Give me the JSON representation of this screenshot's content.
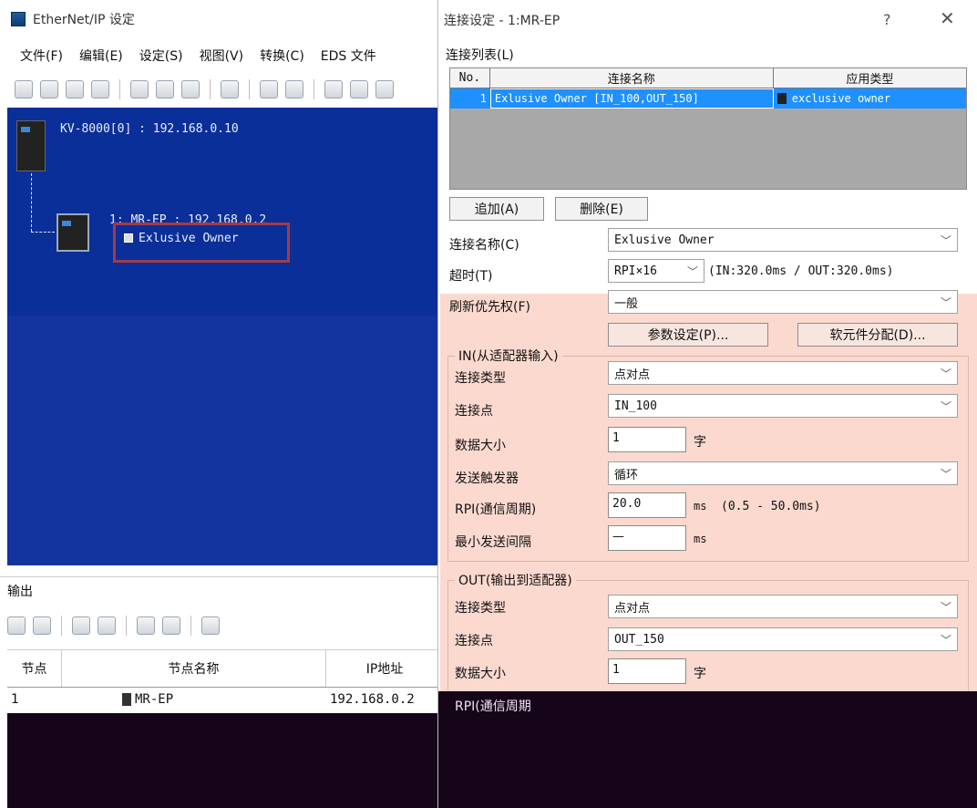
{
  "main_window": {
    "title": "EtherNet/IP 设定",
    "menu": [
      "文件(F)",
      "编辑(E)",
      "设定(S)",
      "视图(V)",
      "转换(C)",
      "EDS 文件"
    ],
    "plc_label": "KV-8000[0] : 192.168.0.10",
    "node_label": "1: MR-EP : 192.168.0.2",
    "connection_label": "Exlusive Owner"
  },
  "output_panel": {
    "title": "输出",
    "columns": [
      "节点",
      "节点名称",
      "IP地址"
    ],
    "rows": [
      {
        "node": "1",
        "name": "MR-EP",
        "ip": "192.168.0.2"
      }
    ]
  },
  "dialog": {
    "title": "连接设定 - 1:MR-EP",
    "help": "?",
    "close": "✕",
    "list_label": "连接列表(L)",
    "list_columns": [
      "No.",
      "连接名称",
      "应用类型"
    ],
    "list_rows": [
      {
        "no": "1",
        "name": "Exlusive Owner [IN_100,OUT_150]",
        "type": "exclusive owner"
      }
    ],
    "add_button": "追加(A)",
    "delete_button": "删除(E)",
    "conn_name_label": "连接名称(C)",
    "conn_name_value": "Exlusive Owner",
    "timeout_label": "超时(T)",
    "timeout_value": "RPI×16",
    "timeout_info": "(IN:320.0ms / OUT:320.0ms)",
    "refresh_label": "刷新优先权(F)",
    "refresh_value": "一般",
    "param_button": "参数设定(P)...",
    "device_button": "软元件分配(D)...",
    "in_group": {
      "title": "IN(从适配器输入)",
      "type_label": "连接类型",
      "type_value": "点对点",
      "point_label": "连接点",
      "point_value": "IN_100",
      "size_label": "数据大小",
      "size_value": "1",
      "size_unit": "字",
      "trigger_label": "发送触发器",
      "trigger_value": "循环",
      "rpi_label": "RPI(通信周期)",
      "rpi_value": "20.0",
      "rpi_unit": "ms",
      "rpi_range": "(0.5 - 50.0ms)",
      "min_label": "最小发送间隔",
      "min_value": "—",
      "min_unit": "ms"
    },
    "out_group": {
      "title": "OUT(输出到适配器)",
      "type_label": "连接类型",
      "type_value": "点对点",
      "point_label": "连接点",
      "point_value": "OUT_150",
      "size_label": "数据大小",
      "size_value": "1",
      "size_unit": "字",
      "rpi_label": "RPI(通信周期"
    }
  }
}
